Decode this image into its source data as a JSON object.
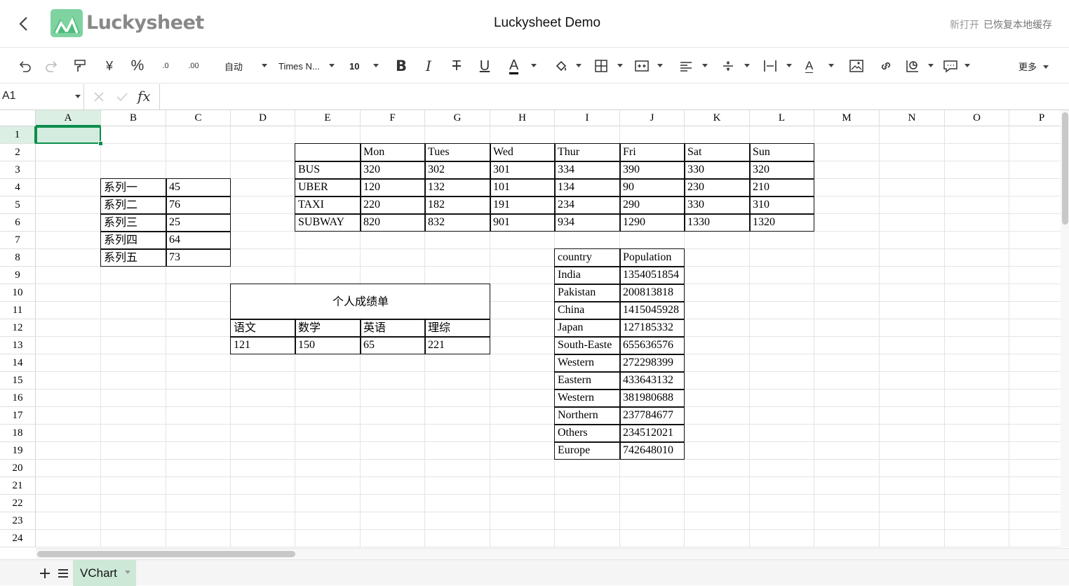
{
  "header": {
    "logo_text": "Luckysheet",
    "title": "Luckysheet Demo",
    "status_new": "新打开",
    "status_saved": "已恢复本地缓存"
  },
  "toolbar": {
    "currency_symbol": "¥",
    "percent_symbol": "%",
    "dec_decrease": ".0",
    "dec_increase": ".00",
    "format_value": "自动",
    "font_value": "Times N...",
    "size_value": "10",
    "bold_label": "B",
    "italic_label": "I",
    "strike_label": "T",
    "underline_label": "U",
    "font_color_label": "A",
    "text_color_label": "A",
    "more_label": "更多",
    "accent_color": "#0b8e4c"
  },
  "formula_bar": {
    "cell_ref": "A1",
    "fx_label": "fx",
    "value": ""
  },
  "columns": [
    "A",
    "B",
    "C",
    "D",
    "E",
    "F",
    "G",
    "H",
    "I",
    "J",
    "K",
    "L",
    "M",
    "N",
    "O",
    "P"
  ],
  "rows": [
    "1",
    "2",
    "3",
    "4",
    "5",
    "6",
    "7",
    "8",
    "9",
    "10",
    "11",
    "12",
    "13",
    "14",
    "15",
    "16",
    "17",
    "18",
    "19",
    "20",
    "21",
    "22",
    "23",
    "24"
  ],
  "series_table": [
    {
      "label": "系列一",
      "value": "45"
    },
    {
      "label": "系列二",
      "value": "76"
    },
    {
      "label": "系列三",
      "value": "25"
    },
    {
      "label": "系列四",
      "value": "64"
    },
    {
      "label": "系列五",
      "value": "73"
    }
  ],
  "transport_table": {
    "days": [
      "Mon",
      "Tues",
      "Wed",
      "Thur",
      "Fri",
      "Sat",
      "Sun"
    ],
    "rows": [
      {
        "name": "BUS",
        "values": [
          "320",
          "302",
          "301",
          "334",
          "390",
          "330",
          "320"
        ]
      },
      {
        "name": "UBER",
        "values": [
          "120",
          "132",
          "101",
          "134",
          "90",
          "230",
          "210"
        ]
      },
      {
        "name": "TAXI",
        "values": [
          "220",
          "182",
          "191",
          "234",
          "290",
          "330",
          "310"
        ]
      },
      {
        "name": "SUBWAY",
        "values": [
          "820",
          "832",
          "901",
          "934",
          "1290",
          "1330",
          "1320"
        ]
      }
    ]
  },
  "score_table": {
    "title": "个人成绩单",
    "subjects": [
      "语文",
      "数学",
      "英语",
      "理综"
    ],
    "scores": [
      "121",
      "150",
      "65",
      "221"
    ]
  },
  "population_table": {
    "headers": [
      "country",
      "Population"
    ],
    "rows": [
      {
        "country": "India",
        "population": "1354051854"
      },
      {
        "country": "Pakistan",
        "population": "200813818"
      },
      {
        "country": "China",
        "population": "1415045928"
      },
      {
        "country": "Japan",
        "population": "127185332"
      },
      {
        "country": "South-Easte",
        "population": "655636576"
      },
      {
        "country": "Western",
        "population": "272298399"
      },
      {
        "country": "Eastern",
        "population": "433643132"
      },
      {
        "country": "Western",
        "population": "381980688"
      },
      {
        "country": "Northern",
        "population": "237784677"
      },
      {
        "country": "Others",
        "population": "234512021"
      },
      {
        "country": "Europe",
        "population": "742648010"
      }
    ]
  },
  "sheet_tabs": [
    {
      "label": "VChart"
    }
  ]
}
